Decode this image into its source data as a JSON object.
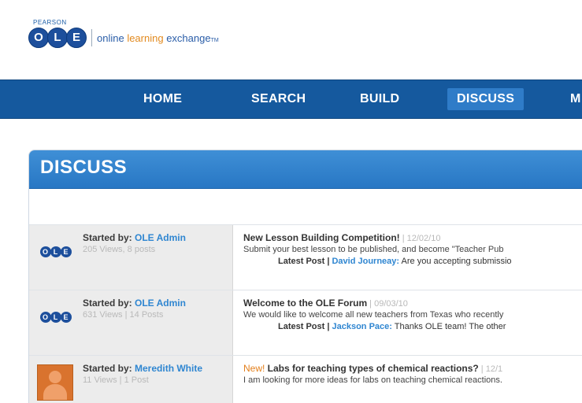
{
  "brand": {
    "publisher": "PEARSON",
    "logo_letters": [
      "O",
      "L",
      "E"
    ],
    "tagline_pre": "online ",
    "tagline_highlight": "learning",
    "tagline_post": " exchange",
    "tagline_tm": "TM"
  },
  "nav": {
    "items": [
      {
        "label": "HOME"
      },
      {
        "label": "SEARCH"
      },
      {
        "label": "BUILD"
      },
      {
        "label": "DISCUSS",
        "active": true
      },
      {
        "label": "M"
      }
    ]
  },
  "panel": {
    "title": "DISCUSS"
  },
  "threads": [
    {
      "started_label": "Started by: ",
      "author": "OLE Admin",
      "stats": "205 Views, 8 posts",
      "new_tag": "",
      "title": "New Lesson Building Competition!",
      "date": " | 12/02/10",
      "description": "Submit your best lesson to be published, and become \"Teacher Pub",
      "latest_label": "Latest Post | ",
      "latest_author": "David Journeay:",
      "latest_text": " Are you accepting submissio"
    },
    {
      "started_label": "Started by: ",
      "author": "OLE Admin",
      "stats": "631 Views | 14 Posts",
      "new_tag": "",
      "title": "Welcome to the OLE Forum",
      "date": " | 09/03/10",
      "description": "We would like to welcome all new teachers from Texas who recently",
      "latest_label": "Latest Post | ",
      "latest_author": "Jackson Pace:",
      "latest_text": " Thanks OLE team!  The other"
    },
    {
      "started_label": "Started by: ",
      "author": "Meredith White",
      "stats": "11 Views | 1 Post",
      "new_tag": "New!",
      "title": " Labs for teaching types of chemical reactions?",
      "date": " | 12/1",
      "description": "I am looking for more ideas for labs on teaching chemical reactions.",
      "latest_label": "",
      "latest_author": "",
      "latest_text": ""
    }
  ],
  "colors": {
    "nav_bg": "#15599e",
    "nav_active": "#2f7cc8",
    "link_blue": "#2f86d1",
    "accent_orange": "#e37f1b"
  }
}
